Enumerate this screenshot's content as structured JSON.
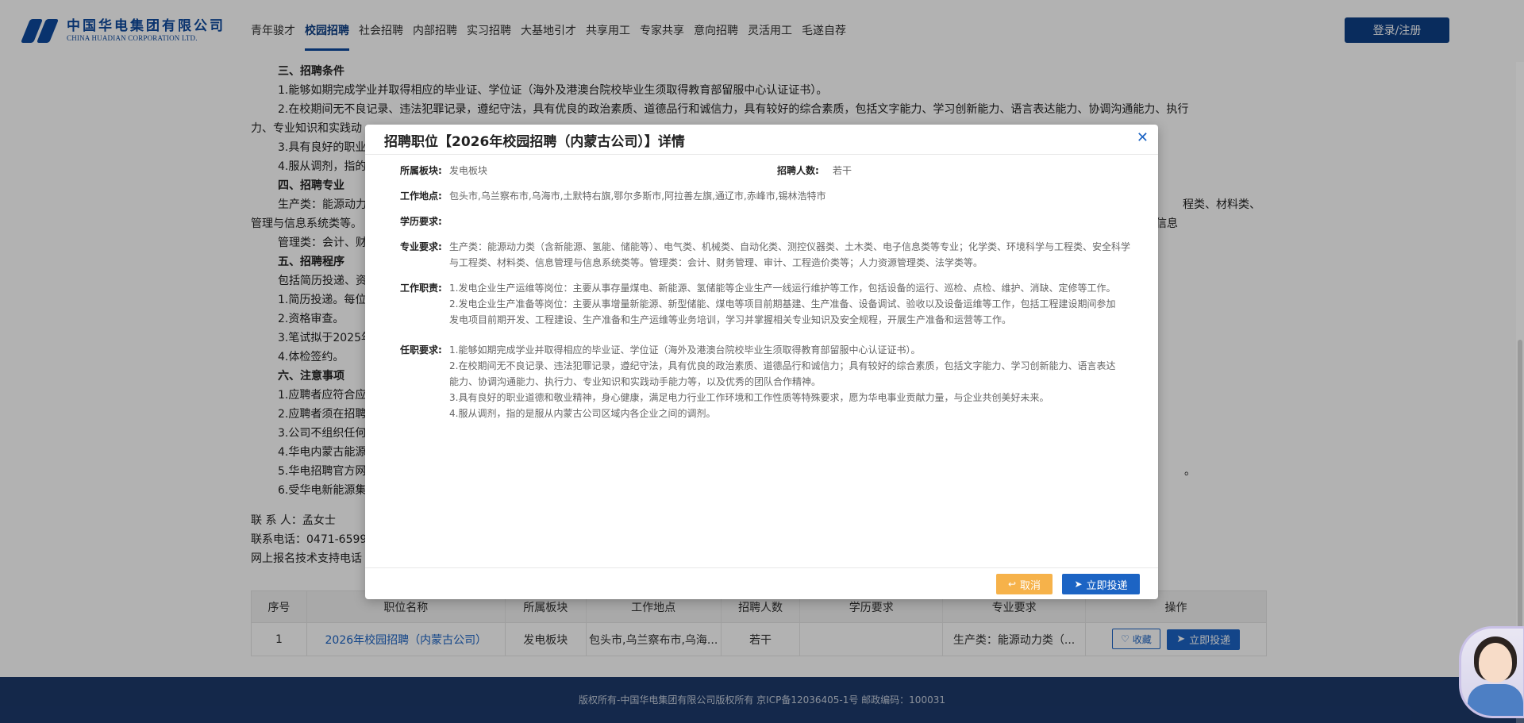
{
  "header": {
    "logo_cn": "中国华电集团有限公司",
    "logo_en": "CHINA HUADIAN CORPORATION LTD.",
    "nav": [
      "青年骏才",
      "校园招聘",
      "社会招聘",
      "内部招聘",
      "实习招聘",
      "大基地引才",
      "共享用工",
      "专家共享",
      "意向招聘",
      "灵活用工",
      "毛遂自荐"
    ],
    "active_nav": "校园招聘",
    "login": "登录/注册"
  },
  "page": {
    "lines": [
      {
        "t": "h",
        "text": "三、招聘条件"
      },
      {
        "t": "p",
        "text": "1.能够如期完成学业并取得相应的毕业证、学位证（海外及港澳台院校毕业生须取得教育部留服中心认证证书）。"
      },
      {
        "t": "p",
        "text": "2.在校期间无不良记录、违法犯罪记录，遵纪守法，具有优良的政治素质、道德品行和诚信力，具有较好的综合素质，包括文字能力、学习创新能力、语言表达能力、协调沟通能力、执行"
      },
      {
        "t": "n",
        "text": "力、专业知识和实践动"
      },
      {
        "t": "p",
        "text": "3.具有良好的职业"
      },
      {
        "t": "p",
        "text": "4.服从调剂，指的"
      },
      {
        "t": "h",
        "text": "四、招聘专业"
      },
      {
        "t": "p",
        "text": "生产类：能源动力"
      },
      {
        "t": "n",
        "text": "管理与信息系统类等。"
      },
      {
        "t": "p",
        "text": "管理类：会计、财"
      },
      {
        "t": "h",
        "text": "五、招聘程序"
      },
      {
        "t": "p",
        "text": "包括简历投递、资"
      },
      {
        "t": "p",
        "text": "1.简历投递。每位"
      },
      {
        "t": "p",
        "text": "2.资格审查。"
      },
      {
        "t": "p",
        "text": "3.笔试拟于2025年"
      },
      {
        "t": "p",
        "text": "4.体检签约。"
      },
      {
        "t": "h",
        "text": "六、注意事项"
      },
      {
        "t": "p",
        "text": "1.应聘者应符合应"
      },
      {
        "t": "p",
        "text": "2.应聘者须在招聘"
      },
      {
        "t": "p",
        "text": "3.公司不组织任何"
      },
      {
        "t": "p",
        "text": "4.华电内蒙古能源"
      },
      {
        "t": "p",
        "text": "5.华电招聘官方网"
      },
      {
        "t": "p",
        "text": "6.受华电新能源集"
      }
    ],
    "right_fragments": {
      "major_tail": "程类、材料类、信息",
      "notice5_tail": "。"
    },
    "contact": [
      "联 系 人：孟女士",
      "联系电话：0471-6599",
      "网上报名技术支持电话"
    ]
  },
  "table": {
    "headers": [
      "序号",
      "职位名称",
      "所属板块",
      "工作地点",
      "招聘人数",
      "学历要求",
      "专业要求",
      "操作"
    ],
    "rows": [
      {
        "no": "1",
        "title": "2026年校园招聘（内蒙古公司）",
        "sector": "发电板块",
        "location": "包头市,乌兰察布市,乌海...",
        "count": "若干",
        "edu": "",
        "major": "生产类：能源动力类（...",
        "fav": "收藏",
        "apply": "立即投递"
      }
    ]
  },
  "footer": "版权所有-中国华电集团有限公司版权所有 京ICP备12036405-1号 邮政编码：100031",
  "modal": {
    "title": "招聘职位【2026年校园招聘（内蒙古公司）】详情",
    "close_icon": "close-icon",
    "labels": {
      "sector": "所属板块:",
      "count": "招聘人数:",
      "location": "工作地点:",
      "edu": "学历要求:",
      "major": "专业要求:",
      "duty": "工作职责:",
      "requirement": "任职要求:"
    },
    "sector": "发电板块",
    "count": "若干",
    "location": "包头市,乌兰察布市,乌海市,土默特右旗,鄂尔多斯市,阿拉善左旗,通辽市,赤峰市,锡林浩特市",
    "edu": "",
    "major": "生产类：能源动力类（含新能源、氢能、储能等）、电气类、机械类、自动化类、测控仪器类、土木类、电子信息类等专业；化学类、环境科学与工程类、安全科学与工程类、材料类、信息管理与信息系统类等。管理类：会计、财务管理、审计、工程造价类等；人力资源管理类、法学类等。",
    "duty": [
      "1.发电企业生产运维等岗位：主要从事存量煤电、新能源、氢储能等企业生产一线运行维护等工作，包括设备的运行、巡检、点检、维护、消缺、定修等工作。",
      "2.发电企业生产准备等岗位：主要从事增量新能源、新型储能、煤电等项目前期基建、生产准备、设备调试、验收以及设备运维等工作，包括工程建设期间参加发电项目前期开发、工程建设、生产准备和生产运维等业务培训，学习并掌握相关专业知识及安全规程，开展生产准备和运营等工作。"
    ],
    "requirement": [
      "1.能够如期完成学业并取得相应的毕业证、学位证（海外及港澳台院校毕业生须取得教育部留服中心认证证书）。",
      "2.在校期间无不良记录、违法犯罪记录，遵纪守法，具有优良的政治素质、道德品行和诚信力；具有较好的综合素质，包括文字能力、学习创新能力、语言表达能力、协调沟通能力、执行力、专业知识和实践动手能力等，以及优秀的团队合作精神。",
      "3.具有良好的职业道德和敬业精神，身心健康，满足电力行业工作环境和工作性质等特殊要求，愿为华电事业贡献力量，与企业共创美好未来。",
      "4.服从调剂，指的是服从内蒙古公司区域内各企业之间的调剂。"
    ],
    "cancel": "取消",
    "apply": "立即投递"
  }
}
